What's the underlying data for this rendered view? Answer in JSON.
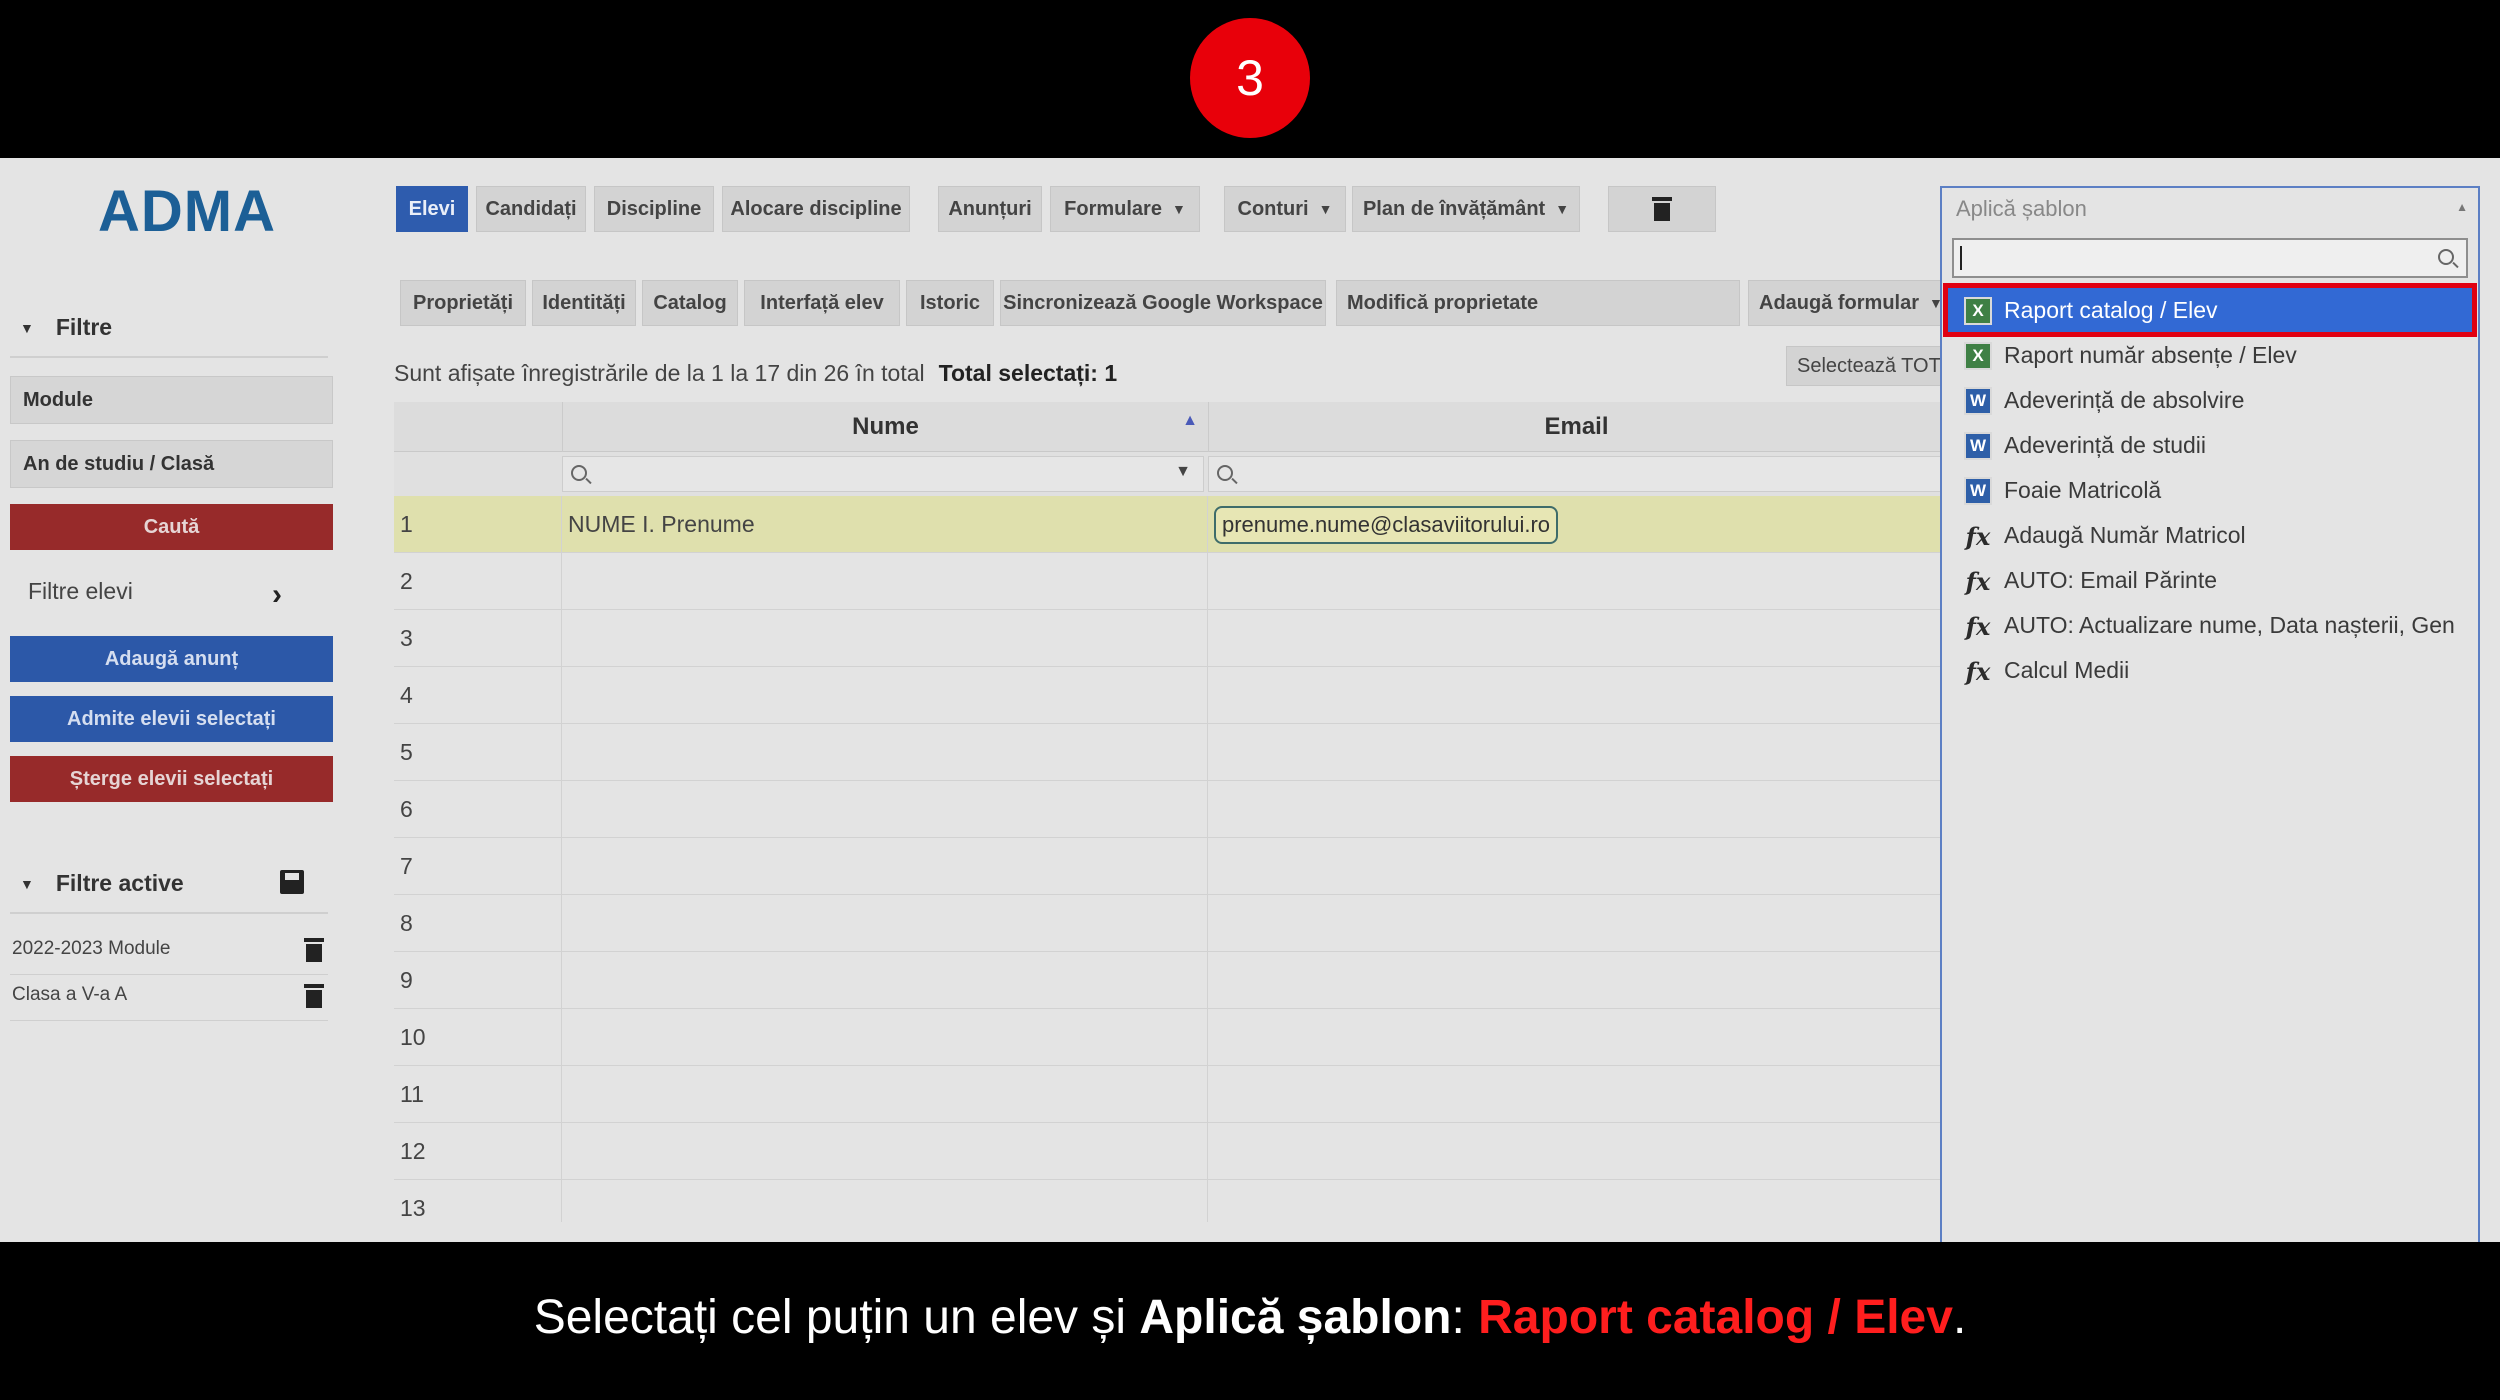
{
  "step": "3",
  "app": {
    "logo": "ADMA",
    "nav": [
      {
        "label": "Elevi"
      },
      {
        "label": "Candidați"
      },
      {
        "label": "Discipline"
      },
      {
        "label": "Alocare discipline"
      },
      {
        "label": "Anunțuri"
      },
      {
        "label": "Formulare"
      },
      {
        "label": "Conturi"
      },
      {
        "label": "Plan de învățământ"
      }
    ],
    "subnav": [
      {
        "label": "Proprietăți"
      },
      {
        "label": "Identități"
      },
      {
        "label": "Catalog"
      },
      {
        "label": "Interfață elev"
      },
      {
        "label": "Istoric"
      },
      {
        "label": "Sincronizează Google Workspace"
      },
      {
        "label": "Modifică proprietate"
      },
      {
        "label": "Adaugă formular"
      }
    ],
    "select_all": "Selectează TOT",
    "info": {
      "records": "Sunt afișate înregistrările de la 1 la 17 din 26 în total",
      "selected": "Total selectați: 1"
    },
    "sidebar": {
      "filters_heading": "Filtre",
      "module": "Module",
      "year_class": "An de studiu / Clasă",
      "search_btn": "Caută",
      "student_filters": "Filtre elevi",
      "add_announcement": "Adaugă anunț",
      "admit_selected": "Admite elevii selectați",
      "delete_selected": "Șterge elevii selectați",
      "active_heading": "Filtre active",
      "active_filters": [
        "2022-2023 Module",
        "Clasa a V-a A"
      ]
    },
    "table": {
      "col_name": "Nume",
      "col_email": "Email",
      "rows": [
        {
          "n": "1",
          "name": "NUME I. Prenume",
          "email": "prenume.nume@clasaviitorului.ro"
        },
        {
          "n": "2",
          "name": "",
          "email": ""
        },
        {
          "n": "3",
          "name": "",
          "email": ""
        },
        {
          "n": "4",
          "name": "",
          "email": ""
        },
        {
          "n": "5",
          "name": "",
          "email": ""
        },
        {
          "n": "6",
          "name": "",
          "email": ""
        },
        {
          "n": "7",
          "name": "",
          "email": ""
        },
        {
          "n": "8",
          "name": "",
          "email": ""
        },
        {
          "n": "9",
          "name": "",
          "email": ""
        },
        {
          "n": "10",
          "name": "",
          "email": ""
        },
        {
          "n": "11",
          "name": "",
          "email": ""
        },
        {
          "n": "12",
          "name": "",
          "email": ""
        },
        {
          "n": "13",
          "name": "",
          "email": ""
        }
      ]
    },
    "template_dropdown": {
      "placeholder": "Aplică șablon",
      "items": [
        {
          "label": "Raport catalog / Elev",
          "icon": "excel-icon"
        },
        {
          "label": "Raport număr absențe / Elev",
          "icon": "excel-icon"
        },
        {
          "label": "Adeverință de absolvire",
          "icon": "word-icon"
        },
        {
          "label": "Adeverință de studii",
          "icon": "word-icon"
        },
        {
          "label": "Foaie Matricolă",
          "icon": "word-icon"
        },
        {
          "label": "Adaugă Număr Matricol",
          "icon": "fx-icon"
        },
        {
          "label": "AUTO: Email Părinte",
          "icon": "fx-icon"
        },
        {
          "label": "AUTO: Actualizare nume, Data nașterii, Gen",
          "icon": "fx-icon"
        },
        {
          "label": "Calcul Medii",
          "icon": "fx-icon"
        }
      ]
    }
  },
  "caption": {
    "part1": "Selectați cel puțin un elev și ",
    "bold": "Aplică șablon",
    "sep": ": ",
    "highlight": "Raport catalog / Elev",
    "end": "."
  }
}
